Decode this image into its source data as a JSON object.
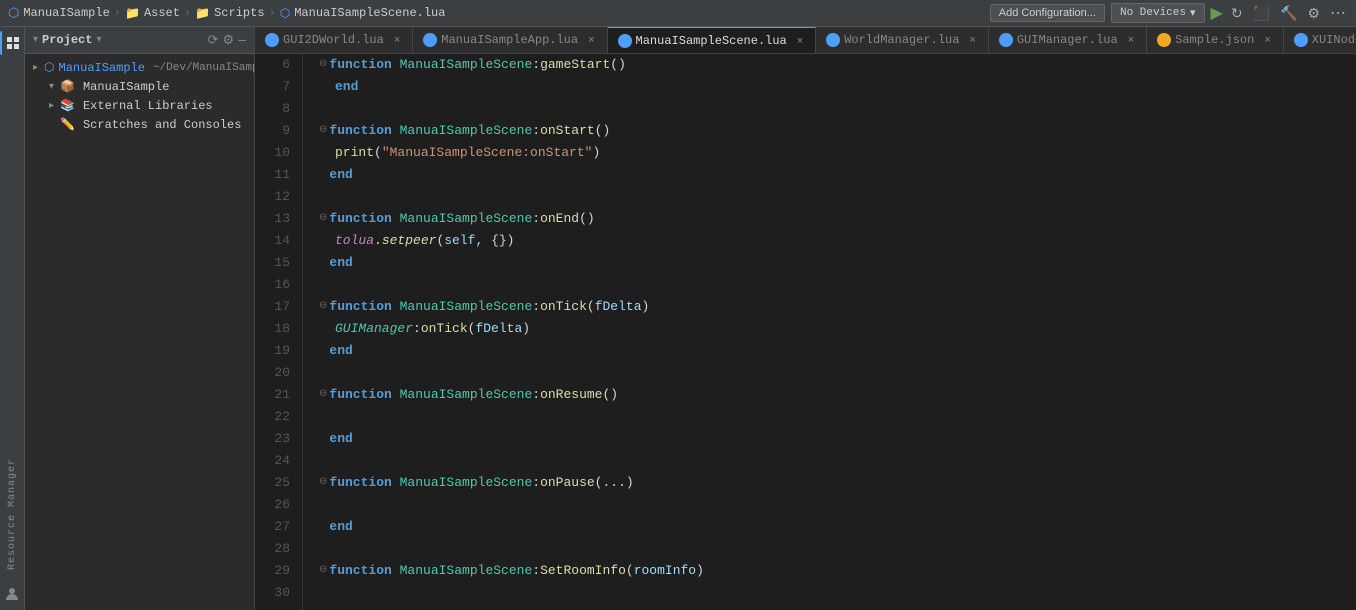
{
  "topbar": {
    "breadcrumbs": [
      {
        "label": "ManuaISample",
        "type": "project"
      },
      {
        "label": "Asset",
        "type": "folder"
      },
      {
        "label": "Scripts",
        "type": "folder"
      },
      {
        "label": "ManuaISampleScene.lua",
        "type": "file"
      }
    ],
    "add_config_label": "Add Configuration...",
    "no_devices_label": "No Devices",
    "chevron_down": "▾",
    "play_icon": "▶",
    "restart_icon": "↺",
    "stop_icon": "⬛",
    "build_icon": "🔨",
    "debug_icon": "🐛",
    "more_icon": "⋯"
  },
  "project_panel": {
    "title": "Project",
    "chevron": "▾",
    "sync_icon": "⟳",
    "settings_icon": "⚙",
    "minus_icon": "—",
    "tree": [
      {
        "label": "ManuaISample",
        "sublabel": "~/Dev/ManuaISample",
        "icon": "📦",
        "arrow": "▸",
        "indent": 0
      },
      {
        "label": "ManuaISample",
        "icon": "📁",
        "arrow": "▾",
        "indent": 1
      },
      {
        "label": "External Libraries",
        "icon": "📚",
        "arrow": "▸",
        "indent": 1
      },
      {
        "label": "Scratches and Consoles",
        "icon": "📝",
        "arrow": "",
        "indent": 1
      }
    ]
  },
  "tabs": [
    {
      "label": "GUI2DWorld.lua",
      "color": "#4e9eff",
      "active": false
    },
    {
      "label": "ManuaISampleApp.lua",
      "color": "#4e9eff",
      "active": false
    },
    {
      "label": "ManuaISampleScene.lua",
      "color": "#4e9eff",
      "active": true
    },
    {
      "label": "WorldManager.lua",
      "color": "#4e9eff",
      "active": false
    },
    {
      "label": "GUIManager.lua",
      "color": "#4e9eff",
      "active": false
    },
    {
      "label": "Sample.json",
      "color": "#f5a623",
      "active": false
    },
    {
      "label": "XUINode.lua",
      "color": "#4e9eff",
      "active": false
    }
  ],
  "code": {
    "lines": [
      {
        "num": 6,
        "content": "",
        "type": "fold-line",
        "text": "function ManuaISampleScene:gameStart()",
        "indent": 0
      },
      {
        "num": 7,
        "content": "    end",
        "type": "end"
      },
      {
        "num": 8,
        "content": "",
        "type": "empty"
      },
      {
        "num": 9,
        "content": "",
        "type": "fold-function",
        "fname": "ManuaISampleScene:onStart",
        "params": "()",
        "indent": 0
      },
      {
        "num": 10,
        "content": "        print(\"ManuaISampleScene:onStart\")",
        "type": "print"
      },
      {
        "num": 11,
        "content": "    end",
        "type": "end"
      },
      {
        "num": 12,
        "content": "",
        "type": "empty"
      },
      {
        "num": 13,
        "content": "",
        "type": "fold-function-onEnd",
        "fname": "ManuaISampleScene:onEnd",
        "params": "()",
        "indent": 0
      },
      {
        "num": 14,
        "content": "        tolua.setpeer(self, {})",
        "type": "tolua"
      },
      {
        "num": 15,
        "content": "    end",
        "type": "end"
      },
      {
        "num": 16,
        "content": "",
        "type": "empty"
      },
      {
        "num": 17,
        "content": "",
        "type": "fold-function-onTick",
        "fname": "ManuaISampleScene:onTick",
        "params": "(fDelta)",
        "indent": 0
      },
      {
        "num": 18,
        "content": "        GUIManager:onTick(fDelta)",
        "type": "guimgr"
      },
      {
        "num": 19,
        "content": "    end",
        "type": "end"
      },
      {
        "num": 20,
        "content": "",
        "type": "empty"
      },
      {
        "num": 21,
        "content": "",
        "type": "fold-function-onResume",
        "fname": "ManuaISampleScene:onResume",
        "params": "()",
        "indent": 0
      },
      {
        "num": 22,
        "content": "",
        "type": "empty"
      },
      {
        "num": 23,
        "content": "    end",
        "type": "end"
      },
      {
        "num": 24,
        "content": "",
        "type": "empty"
      },
      {
        "num": 25,
        "content": "",
        "type": "fold-function-onPause",
        "fname": "ManuaISampleScene:onPause",
        "params": "(...)",
        "indent": 0
      },
      {
        "num": 26,
        "content": "",
        "type": "empty"
      },
      {
        "num": 27,
        "content": "    end",
        "type": "end"
      },
      {
        "num": 28,
        "content": "",
        "type": "empty"
      },
      {
        "num": 29,
        "content": "",
        "type": "fold-function-SetRoomInfo",
        "fname": "ManuaISampleScene:SetRoomInfo",
        "params": "(roomInfo)",
        "indent": 0
      },
      {
        "num": 30,
        "content": "",
        "type": "empty"
      }
    ]
  },
  "activity": {
    "project_icon": "📁",
    "resource_label": "Resource Manager"
  }
}
